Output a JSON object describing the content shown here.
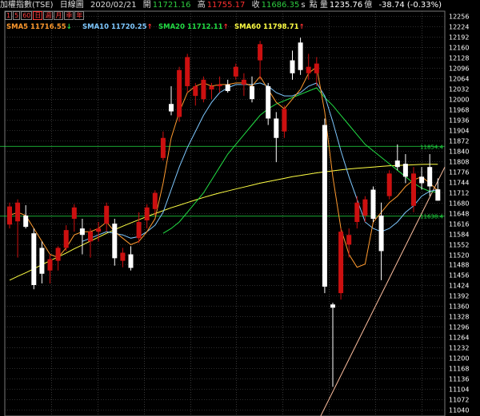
{
  "header": {
    "index_name": "加權指數(TSE)",
    "chart_kind": "日線圖",
    "date": "2020/02/21",
    "open_label": "開",
    "open_value": "11721.16",
    "high_label": "高",
    "high_value": "11755.17",
    "close_label": "收",
    "close_value": "11686.35",
    "close_flag": "s",
    "volume_label": "點 量",
    "volume_value": "1235.76",
    "volume_unit": "億",
    "change_value": "-38.74 (-0.33%)"
  },
  "period_tabs": [
    "1",
    "5",
    "60",
    "日",
    "週",
    "月",
    "季",
    "年"
  ],
  "colors": {
    "up": "#cc1010",
    "down": "#ffffff",
    "sma5": "#ff9a2e",
    "sma10": "#7ec8ff",
    "sma20": "#22dd44",
    "sma60": "#ffff44",
    "grid": "#5a5a5a",
    "ref_line": "#22dd44",
    "trend_line": "#ffc0a0"
  },
  "chart_data": {
    "type": "candlestick",
    "ylim": [
      11020,
      12272
    ],
    "yticks": [
      11040,
      11072,
      11104,
      11136,
      11168,
      11200,
      11232,
      11264,
      11296,
      11328,
      11360,
      11392,
      11424,
      11456,
      11488,
      11520,
      11552,
      11584,
      11616,
      11648,
      11680,
      11712,
      11744,
      11776,
      11808,
      11840,
      11872,
      11904,
      11936,
      11968,
      12000,
      12032,
      12064,
      12096,
      12128,
      12160,
      12192,
      12224,
      12256
    ],
    "legend": [
      {
        "name": "SMA5",
        "value": "11716.55",
        "arrow": "↓",
        "key": "sma5"
      },
      {
        "name": "SMA10",
        "value": "11720.25",
        "arrow": "↑",
        "key": "sma10"
      },
      {
        "name": "SMA20",
        "value": "11712.11",
        "arrow": "↑",
        "key": "sma20"
      },
      {
        "name": "SMA60",
        "value": "11798.71",
        "arrow": "↑",
        "key": "sma60"
      }
    ],
    "reference_lines": [
      {
        "label": "11854.4",
        "value": 11854
      },
      {
        "label": "11638.4",
        "value": 11638
      }
    ],
    "candles": [
      {
        "o": 11612,
        "h": 11680,
        "l": 11600,
        "c": 11668
      },
      {
        "o": 11622,
        "h": 11690,
        "l": 11510,
        "c": 11680
      },
      {
        "o": 11640,
        "h": 11672,
        "l": 11600,
        "c": 11605
      },
      {
        "o": 11585,
        "h": 11600,
        "l": 11412,
        "c": 11425
      },
      {
        "o": 11540,
        "h": 11560,
        "l": 11430,
        "c": 11460
      },
      {
        "o": 11470,
        "h": 11520,
        "l": 11430,
        "c": 11505
      },
      {
        "o": 11500,
        "h": 11545,
        "l": 11470,
        "c": 11540
      },
      {
        "o": 11540,
        "h": 11610,
        "l": 11530,
        "c": 11595
      },
      {
        "o": 11630,
        "h": 11675,
        "l": 11590,
        "c": 11665
      },
      {
        "o": 11600,
        "h": 11630,
        "l": 11520,
        "c": 11580
      },
      {
        "o": 11560,
        "h": 11600,
        "l": 11510,
        "c": 11590
      },
      {
        "o": 11590,
        "h": 11620,
        "l": 11560,
        "c": 11600
      },
      {
        "o": 11615,
        "h": 11680,
        "l": 11590,
        "c": 11670
      },
      {
        "o": 11615,
        "h": 11630,
        "l": 11485,
        "c": 11508
      },
      {
        "o": 11500,
        "h": 11540,
        "l": 11480,
        "c": 11525
      },
      {
        "o": 11520,
        "h": 11545,
        "l": 11470,
        "c": 11478
      },
      {
        "o": 11570,
        "h": 11650,
        "l": 11555,
        "c": 11620
      },
      {
        "o": 11625,
        "h": 11675,
        "l": 11600,
        "c": 11665
      },
      {
        "o": 11660,
        "h": 11718,
        "l": 11640,
        "c": 11710
      },
      {
        "o": 11818,
        "h": 11900,
        "l": 11810,
        "c": 11880
      },
      {
        "o": 11985,
        "h": 12040,
        "l": 11950,
        "c": 11962
      },
      {
        "o": 11945,
        "h": 12100,
        "l": 11930,
        "c": 12090
      },
      {
        "o": 12040,
        "h": 12140,
        "l": 12020,
        "c": 12130
      },
      {
        "o": 12010,
        "h": 12050,
        "l": 11980,
        "c": 12040
      },
      {
        "o": 12000,
        "h": 12070,
        "l": 11990,
        "c": 12060
      },
      {
        "o": 12030,
        "h": 12050,
        "l": 12000,
        "c": 12040
      },
      {
        "o": 12040,
        "h": 12070,
        "l": 12020,
        "c": 12045
      },
      {
        "o": 12045,
        "h": 12060,
        "l": 12020,
        "c": 12025
      },
      {
        "o": 12070,
        "h": 12110,
        "l": 12060,
        "c": 12100
      },
      {
        "o": 12045,
        "h": 12080,
        "l": 12010,
        "c": 12060
      },
      {
        "o": 12040,
        "h": 12070,
        "l": 11990,
        "c": 12000
      },
      {
        "o": 12120,
        "h": 12180,
        "l": 12060,
        "c": 12170
      },
      {
        "o": 12040,
        "h": 12050,
        "l": 11920,
        "c": 11940
      },
      {
        "o": 11940,
        "h": 11960,
        "l": 11805,
        "c": 11880
      },
      {
        "o": 11900,
        "h": 11980,
        "l": 11880,
        "c": 11970
      },
      {
        "o": 12120,
        "h": 12150,
        "l": 12060,
        "c": 12080
      },
      {
        "o": 12175,
        "h": 12190,
        "l": 12075,
        "c": 12090
      },
      {
        "o": 12080,
        "h": 12140,
        "l": 12060,
        "c": 12100
      },
      {
        "o": 12080,
        "h": 12130,
        "l": 12040,
        "c": 12110
      },
      {
        "o": 11920,
        "h": 11940,
        "l": 11400,
        "c": 11420
      },
      {
        "o": 11365,
        "h": 11370,
        "l": 11110,
        "c": 11355
      },
      {
        "o": 11400,
        "h": 11600,
        "l": 11380,
        "c": 11590
      },
      {
        "o": 11550,
        "h": 11600,
        "l": 11510,
        "c": 11580
      },
      {
        "o": 11620,
        "h": 11700,
        "l": 11600,
        "c": 11680
      },
      {
        "o": 11640,
        "h": 11700,
        "l": 11620,
        "c": 11690
      },
      {
        "o": 11720,
        "h": 11730,
        "l": 11620,
        "c": 11630
      },
      {
        "o": 11640,
        "h": 11680,
        "l": 11440,
        "c": 11530
      },
      {
        "o": 11700,
        "h": 11780,
        "l": 11690,
        "c": 11770
      },
      {
        "o": 11810,
        "h": 11860,
        "l": 11780,
        "c": 11790
      },
      {
        "o": 11800,
        "h": 11830,
        "l": 11740,
        "c": 11760
      },
      {
        "o": 11670,
        "h": 11790,
        "l": 11650,
        "c": 11770
      },
      {
        "o": 11760,
        "h": 11790,
        "l": 11720,
        "c": 11740
      },
      {
        "o": 11790,
        "h": 11830,
        "l": 11700,
        "c": 11730
      },
      {
        "o": 11721,
        "h": 11755,
        "l": 11686,
        "c": 11686
      }
    ],
    "sma5": [
      11640,
      11650,
      11640,
      11600,
      11560,
      11520,
      11510,
      11540,
      11580,
      11590,
      11590,
      11600,
      11620,
      11590,
      11570,
      11550,
      11560,
      11590,
      11630,
      11740,
      11880,
      11960,
      12020,
      12040,
      12050,
      12040,
      12045,
      12045,
      12050,
      12050,
      12040,
      12070,
      12030,
      11990,
      11970,
      12000,
      12030,
      12080,
      12100,
      11960,
      11760,
      11600,
      11520,
      11480,
      11490,
      11620,
      11650,
      11680,
      11700,
      11730,
      11750,
      11760,
      11740,
      11717
    ],
    "sma10": [
      null,
      null,
      null,
      null,
      null,
      null,
      null,
      null,
      null,
      11560,
      11570,
      11580,
      11590,
      11585,
      11580,
      11570,
      11575,
      11590,
      11610,
      11650,
      11720,
      11790,
      11850,
      11900,
      11950,
      11990,
      12020,
      12035,
      12045,
      12045,
      12045,
      12050,
      12040,
      12020,
      12010,
      12010,
      12020,
      12040,
      12050,
      12010,
      11930,
      11840,
      11760,
      11690,
      11620,
      11600,
      11590,
      11600,
      11620,
      11650,
      11670,
      11700,
      11715,
      11720
    ],
    "sma20": [
      null,
      null,
      null,
      null,
      null,
      null,
      null,
      null,
      null,
      null,
      null,
      null,
      null,
      null,
      null,
      null,
      null,
      null,
      null,
      11585,
      11600,
      11620,
      11650,
      11680,
      11710,
      11750,
      11790,
      11830,
      11860,
      11890,
      11920,
      11950,
      11970,
      11985,
      11995,
      12005,
      12015,
      12025,
      12035,
      12005,
      11980,
      11950,
      11920,
      11890,
      11860,
      11840,
      11820,
      11800,
      11780,
      11760,
      11740,
      11725,
      11715,
      11712
    ],
    "sma60": [
      11440,
      11452,
      11463,
      11475,
      11488,
      11500,
      11512,
      11524,
      11537,
      11549,
      11561,
      11573,
      11585,
      11596,
      11607,
      11617,
      11627,
      11637,
      11646,
      11655,
      11664,
      11672,
      11680,
      11688,
      11696,
      11703,
      11710,
      11716,
      11722,
      11728,
      11734,
      11740,
      11745,
      11750,
      11755,
      11760,
      11764,
      11768,
      11772,
      11775,
      11778,
      11781,
      11784,
      11786,
      11788,
      11790,
      11792,
      11794,
      11795,
      11796,
      11797,
      11798,
      11798.5,
      11798.71
    ]
  }
}
